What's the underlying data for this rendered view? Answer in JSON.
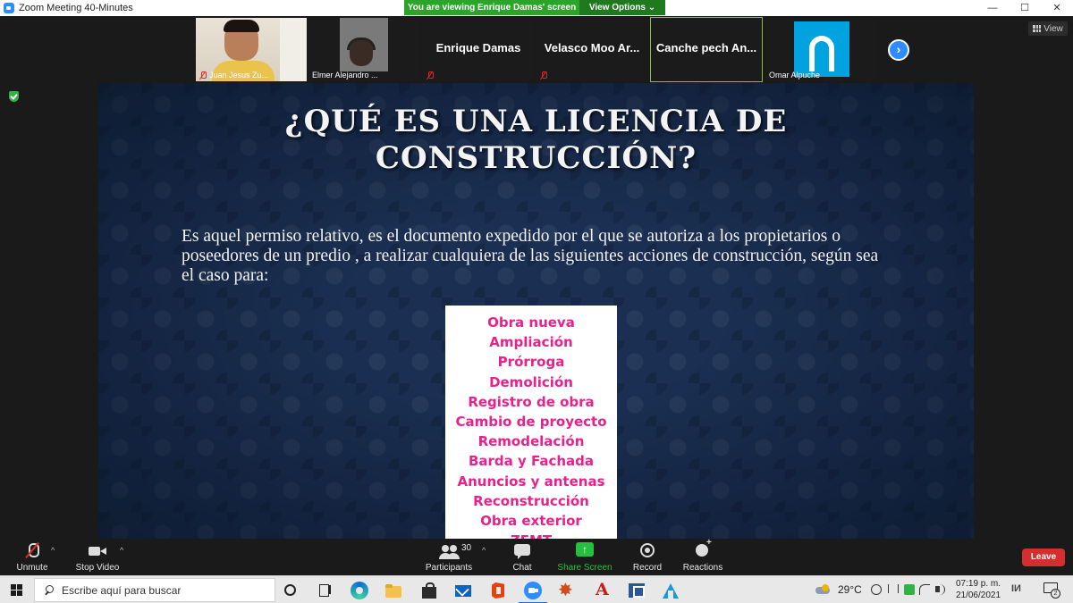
{
  "window": {
    "title": "Zoom Meeting 40-Minutes",
    "controls": [
      "—",
      "☐",
      "✕"
    ]
  },
  "share": {
    "banner": "You are viewing Enrique Damas' screen",
    "view_options": "View Options ⌄"
  },
  "view_button": "View",
  "participants": [
    {
      "name": "Juan Jesus Zu...",
      "muted": true
    },
    {
      "name": "Elmer Alejandro ...",
      "muted": false
    },
    {
      "name": "Enrique Damas",
      "muted": true
    },
    {
      "name": "Velasco Moo Ar...",
      "muted": true
    },
    {
      "name": "Canche pech An...",
      "muted": false
    },
    {
      "name": "Omar Alpuche",
      "muted": false
    }
  ],
  "slide": {
    "title_line1": "¿QUÉ ES UNA LICENCIA DE",
    "title_line2": "CONSTRUCCIÓN?",
    "body": "Es aquel permiso relativo, es el documento expedido por el que se autoriza a los propietarios o poseedores de un predio , a realizar cualquiera de las siguientes acciones de construcción, según sea el caso para:",
    "list": [
      "Obra nueva",
      "Ampliación",
      "Prórroga",
      "Demolición",
      "Registro de obra",
      "Cambio de proyecto",
      "Remodelación",
      "Barda y Fachada",
      "Anuncios y antenas",
      "Reconstrucción",
      "Obra exterior",
      "ZEMT"
    ]
  },
  "toolbar": {
    "unmute": "Unmute",
    "stop_video": "Stop Video",
    "participants": "Participants",
    "participants_count": "30",
    "chat": "Chat",
    "share_screen": "Share Screen",
    "record": "Record",
    "reactions": "Reactions",
    "leave": "Leave",
    "caret": "^"
  },
  "taskbar": {
    "search_placeholder": "Escribe aquí para buscar",
    "temperature": "29°C",
    "time": "07:19 p. m.",
    "date": "21/06/2021",
    "notification_count": "2"
  },
  "colors": {
    "share_green": "#2aa52a",
    "zoom_blue": "#2d8cff",
    "leave_red": "#d32f2f",
    "slide_pink": "#e8218c"
  }
}
